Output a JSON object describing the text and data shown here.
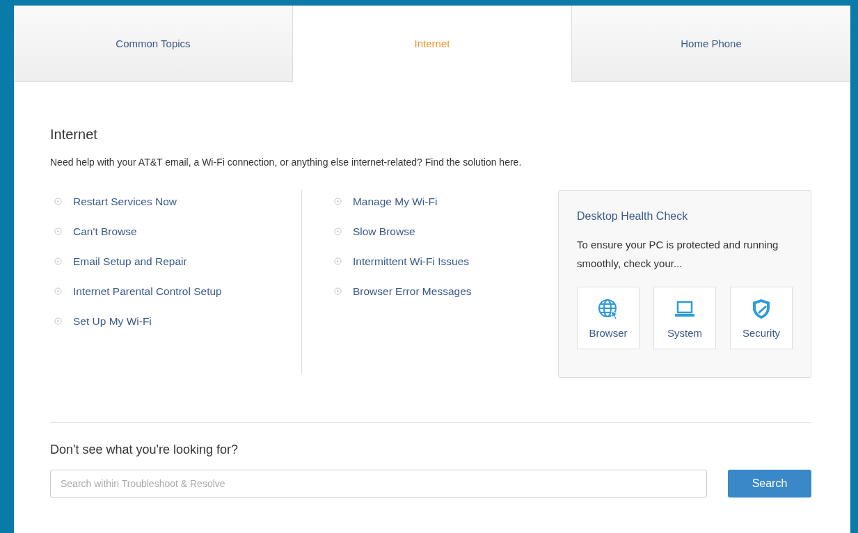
{
  "tabs": [
    {
      "label": "Common Topics",
      "selected": false
    },
    {
      "label": "Internet",
      "selected": true
    },
    {
      "label": "Home Phone",
      "selected": false
    }
  ],
  "section": {
    "title": "Internet",
    "description": "Need help with your AT&T email, a Wi-Fi connection, or anything else internet-related? Find the solution here."
  },
  "link_columns": [
    [
      "Restart Services Now",
      "Can't Browse",
      "Email Setup and Repair",
      "Internet Parental Control Setup",
      "Set Up My Wi-Fi"
    ],
    [
      "Manage My Wi-Fi",
      "Slow Browse",
      "Intermittent Wi-Fi Issues",
      "Browser Error Messages"
    ]
  ],
  "health_check": {
    "title": "Desktop Health Check",
    "text": "To ensure your PC is protected and running smoothly, check your...",
    "buttons": [
      {
        "kind": "browser",
        "label": "Browser"
      },
      {
        "kind": "system",
        "label": "System"
      },
      {
        "kind": "security",
        "label": "Security"
      }
    ]
  },
  "search": {
    "heading": "Don't see what you're looking for?",
    "placeholder": "Search within Troubleshoot & Resolve",
    "button": "Search"
  }
}
